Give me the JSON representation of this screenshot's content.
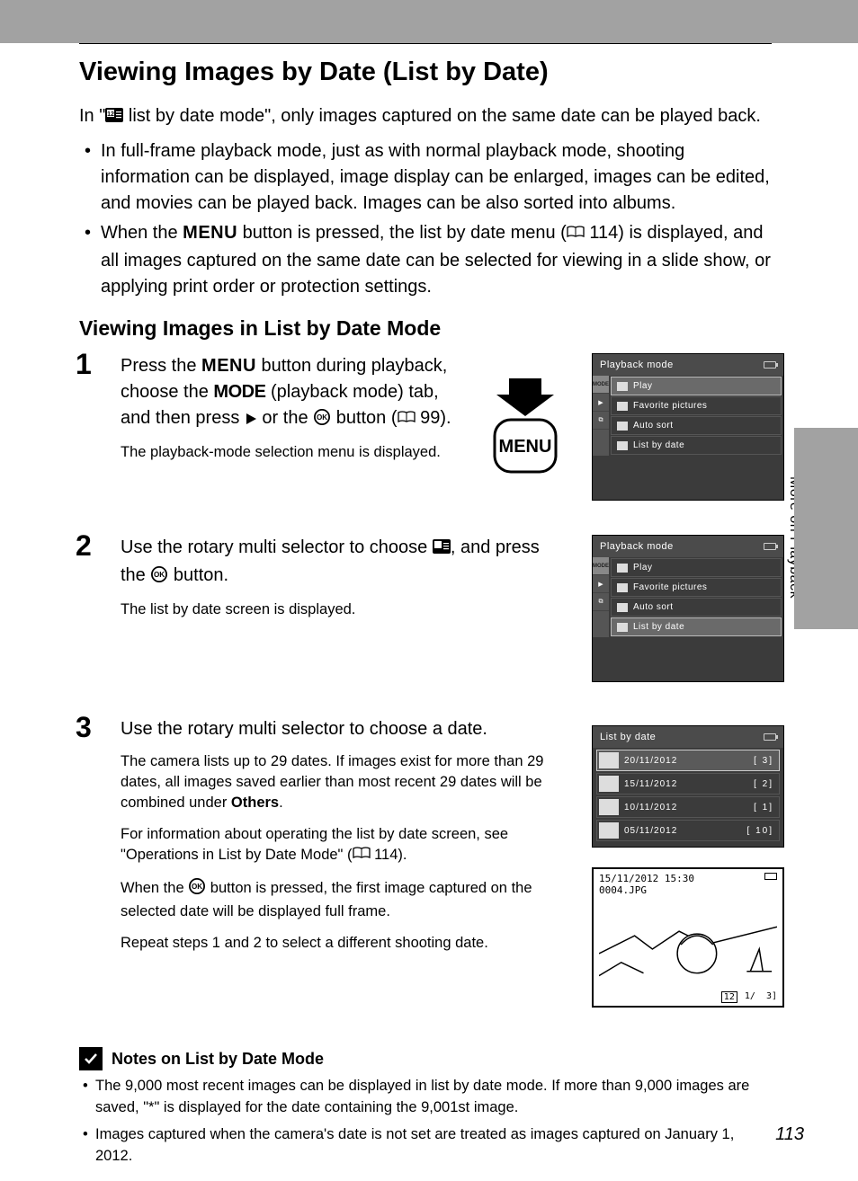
{
  "title": "Viewing Images by Date (List by Date)",
  "intro": {
    "pre": "In \"",
    "post": " list by date mode\", only images captured on the same date can be played back."
  },
  "bullets": [
    "In full-frame playback mode, just as with normal playback mode, shooting information can be displayed, image display can be enlarged, images can be edited, and movies can be played back. Images can be also sorted into albums.",
    {
      "pre": "When the ",
      "menu": "MENU",
      "mid": " button is pressed, the list by date menu (",
      "ref": " 114) is displayed, and all images captured on the same date can be selected for viewing in a slide show, or applying print order or protection settings."
    }
  ],
  "subheading": "Viewing Images in List by Date Mode",
  "steps": {
    "s1": {
      "num": "1",
      "line1a": "Press the ",
      "menu": "MENU",
      "line1b": " button during playback, choose the ",
      "mode": "MODE",
      "line1c": " (playback mode) tab, and then press ",
      "line1d": " or the ",
      "line1e": " button (",
      "ref": " 99).",
      "note": "The playback-mode selection menu is displayed."
    },
    "s2": {
      "num": "2",
      "line_a": "Use the rotary multi selector to choose ",
      "line_b": ", and press the ",
      "line_c": " button.",
      "note": "The list by date screen is displayed."
    },
    "s3": {
      "num": "3",
      "line": "Use the rotary multi selector to choose a date.",
      "n1a": "The camera lists up to 29 dates. If images exist for more than 29 dates, all images saved earlier than most recent 29 dates will be combined under ",
      "n1b": "Others",
      "n1c": ".",
      "n2a": "For information about operating the list by date screen, see \"Operations in List by Date Mode\" (",
      "n2b": " 114).",
      "n3a": "When the ",
      "n3b": " button is pressed, the first image captured on the selected date will be displayed full frame.",
      "n4": "Repeat steps 1 and 2 to select a different shooting date."
    }
  },
  "screens": {
    "pbmode_title": "Playback mode",
    "items": [
      "Play",
      "Favorite pictures",
      "Auto sort",
      "List by date"
    ],
    "tabs_mode": "MODE",
    "listbydate_title": "List by date",
    "dates": [
      {
        "d": "20/11/2012",
        "c": "3"
      },
      {
        "d": "15/11/2012",
        "c": "2"
      },
      {
        "d": "10/11/2012",
        "c": "1"
      },
      {
        "d": "05/11/2012",
        "c": "10"
      }
    ],
    "preview": {
      "ts": "15/11/2012 15:30",
      "file": "0004.JPG",
      "idx": "1/",
      "total": "3"
    }
  },
  "menu_button_label": "MENU",
  "side_label": "More on Playback",
  "notes": {
    "heading": "Notes on List by Date Mode",
    "items": [
      "The 9,000 most recent images can be displayed in list by date mode. If more than 9,000 images are saved, \"*\" is displayed for the date containing the 9,001st image.",
      "Images captured when the camera's date is not set are treated as images captured on January 1, 2012."
    ]
  },
  "page_number": "113"
}
